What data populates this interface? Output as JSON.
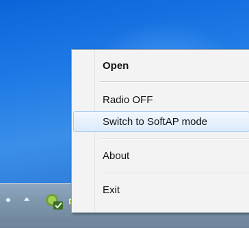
{
  "menu": {
    "items": [
      {
        "label": "Open",
        "bold": true
      },
      {
        "label": "Radio OFF"
      },
      {
        "label": "Switch to SoftAP mode",
        "highlighted": true
      },
      {
        "label": "About"
      },
      {
        "label": "Exit"
      }
    ]
  },
  "tray": {
    "icons": [
      "expand-arrow-icon",
      "wireless-utility-icon",
      "signal-bars-icon",
      "network-icon",
      "signal-bars-icon"
    ]
  },
  "colors": {
    "desktop": "#1f7ae6",
    "taskbar": "#7f97ad",
    "menu_background": "#f3f3f3",
    "highlight_border": "#a9cdf1"
  }
}
